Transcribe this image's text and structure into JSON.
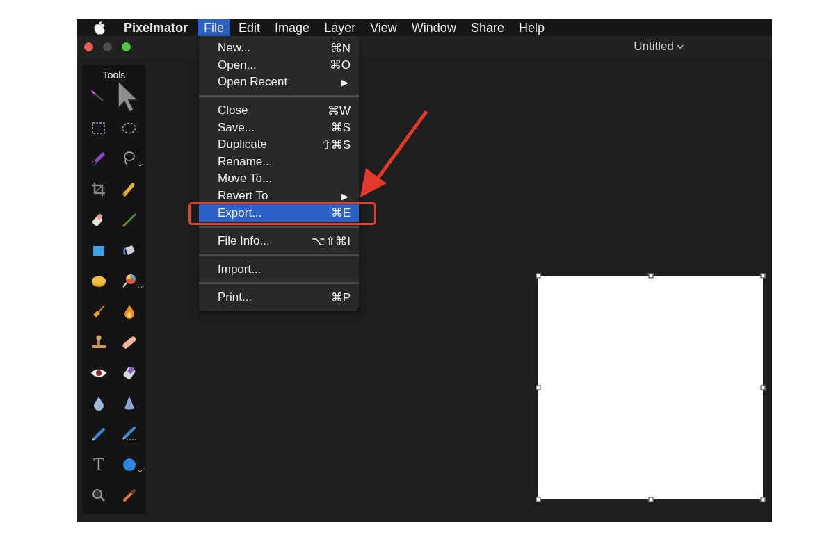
{
  "menu_bar": {
    "app_name": "Pixelmator",
    "items": [
      {
        "label": "File",
        "selected": true
      },
      {
        "label": "Edit",
        "selected": false
      },
      {
        "label": "Image",
        "selected": false
      },
      {
        "label": "Layer",
        "selected": false
      },
      {
        "label": "View",
        "selected": false
      },
      {
        "label": "Window",
        "selected": false
      },
      {
        "label": "Share",
        "selected": false
      },
      {
        "label": "Help",
        "selected": false
      }
    ]
  },
  "window": {
    "title": "Untitled"
  },
  "tools_panel": {
    "title": "Tools",
    "tools": [
      {
        "kind": "magic-wand"
      },
      {
        "kind": "pointer"
      },
      {
        "kind": "rect-select"
      },
      {
        "kind": "ellipse-select"
      },
      {
        "kind": "brush-select"
      },
      {
        "kind": "lasso",
        "has_menu": true
      },
      {
        "kind": "crop"
      },
      {
        "kind": "pencil"
      },
      {
        "kind": "eraser"
      },
      {
        "kind": "brush"
      },
      {
        "kind": "rectangle"
      },
      {
        "kind": "bucket"
      },
      {
        "kind": "coin"
      },
      {
        "kind": "lollipop",
        "has_menu": true
      },
      {
        "kind": "broom"
      },
      {
        "kind": "flame"
      },
      {
        "kind": "stamp"
      },
      {
        "kind": "bandage"
      },
      {
        "kind": "eye"
      },
      {
        "kind": "purple-eraser"
      },
      {
        "kind": "drop"
      },
      {
        "kind": "cone"
      },
      {
        "kind": "pen"
      },
      {
        "kind": "pen-dots"
      },
      {
        "kind": "text",
        "glyph": "T"
      },
      {
        "kind": "circle",
        "has_menu": true
      },
      {
        "kind": "magnifier"
      },
      {
        "kind": "eyedropper"
      }
    ]
  },
  "file_menu": {
    "items": [
      {
        "kind": "item",
        "label": "New...",
        "shortcut": "⌘N",
        "selected": false
      },
      {
        "kind": "item",
        "label": "Open...",
        "shortcut": "⌘O",
        "selected": false
      },
      {
        "kind": "item",
        "label": "Open Recent",
        "arrow": "▶",
        "selected": false
      },
      {
        "kind": "separator"
      },
      {
        "kind": "item",
        "label": "Close",
        "shortcut": "⌘W",
        "selected": false
      },
      {
        "kind": "item",
        "label": "Save...",
        "shortcut": "⌘S",
        "selected": false
      },
      {
        "kind": "item",
        "label": "Duplicate",
        "shortcut": "⇧⌘S",
        "selected": false
      },
      {
        "kind": "item",
        "label": "Rename...",
        "selected": false
      },
      {
        "kind": "item",
        "label": "Move To...",
        "selected": false
      },
      {
        "kind": "item",
        "label": "Revert To",
        "arrow": "▶",
        "selected": false
      },
      {
        "kind": "item",
        "label": "Export...",
        "shortcut": "⌘E",
        "selected": true
      },
      {
        "kind": "separator"
      },
      {
        "kind": "item",
        "label": "File Info...",
        "shortcut": "⌥⇧⌘I",
        "selected": false
      },
      {
        "kind": "separator"
      },
      {
        "kind": "item",
        "label": "Import...",
        "selected": false
      },
      {
        "kind": "separator"
      },
      {
        "kind": "item",
        "label": "Print...",
        "shortcut": "⌘P",
        "selected": false
      }
    ]
  }
}
